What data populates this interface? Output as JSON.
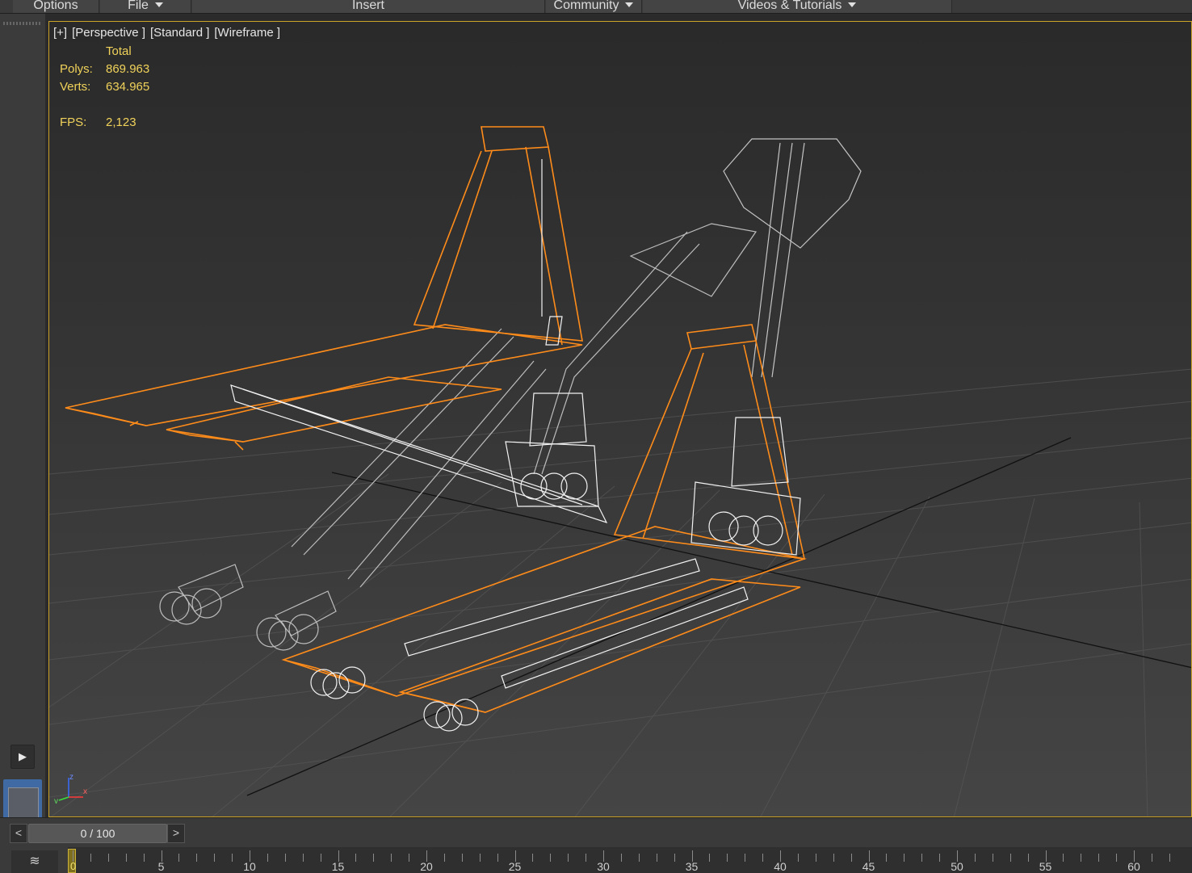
{
  "menubar": {
    "items": [
      {
        "label": "Options",
        "dropdown": false
      },
      {
        "label": "File",
        "dropdown": true
      },
      {
        "label": "Insert",
        "dropdown": false
      },
      {
        "label": "Community",
        "dropdown": true
      },
      {
        "label": "Videos & Tutorials",
        "dropdown": true
      }
    ]
  },
  "viewport": {
    "labels": [
      "[+]",
      "[Perspective ]",
      "[Standard ]",
      "[Wireframe ]"
    ],
    "stats": {
      "header": "Total",
      "polys_label": "Polys:",
      "polys_value": "869.963",
      "verts_label": "Verts:",
      "verts_value": "634.965",
      "fps_label": "FPS:",
      "fps_value": "2,123"
    },
    "axis": {
      "x": "x",
      "y": "y",
      "z": "z"
    },
    "colors": {
      "selected_wire": "#ff8c1a",
      "unselected_wire": "#c8c8c8",
      "detail_wire": "#ffffff",
      "grid": "#5a5a5a",
      "border": "#c9a227",
      "stats_text": "#f0d25a"
    }
  },
  "timeline": {
    "prev_label": "<",
    "next_label": ">",
    "frame_display": "0 / 100",
    "current_frame": 0,
    "tick_labels": [
      "0",
      "5",
      "10",
      "15",
      "20",
      "25",
      "30",
      "35",
      "40",
      "45",
      "50",
      "55",
      "60"
    ],
    "curve_icon": "curve-editor-icon"
  },
  "leftdock": {
    "play_icon": "play-icon"
  }
}
